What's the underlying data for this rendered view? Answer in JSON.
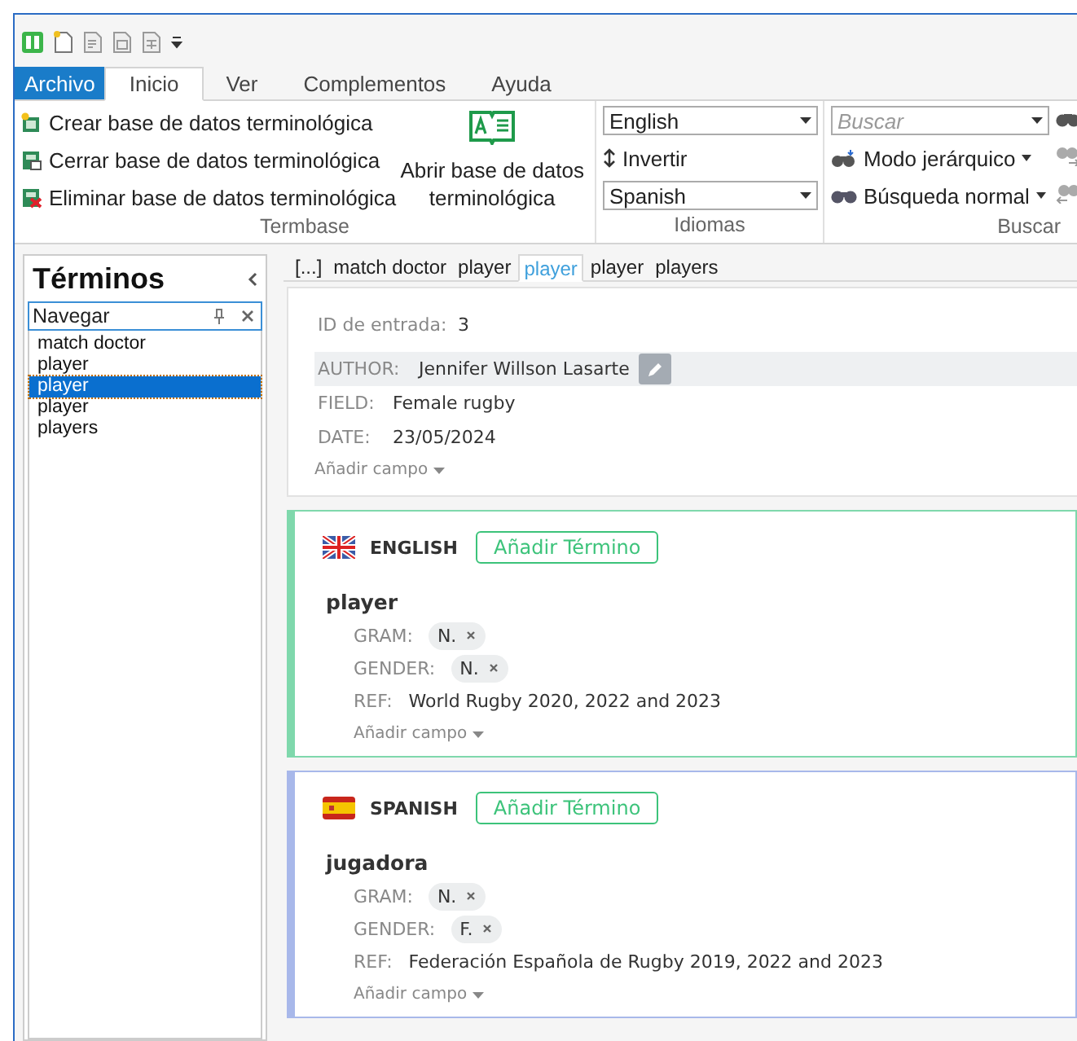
{
  "menu_tabs": [
    {
      "label": "Archivo",
      "kind": "file",
      "selected": false
    },
    {
      "label": "Inicio",
      "kind": "tab",
      "selected": true
    },
    {
      "label": "Ver",
      "kind": "tab",
      "selected": false
    },
    {
      "label": "Complementos",
      "kind": "tab",
      "selected": false
    },
    {
      "label": "Ayuda",
      "kind": "tab",
      "selected": false
    }
  ],
  "ribbon": {
    "termbase": {
      "caption": "Termbase",
      "commands": [
        {
          "label": "Crear base de datos terminológica",
          "kind": "create"
        },
        {
          "label": "Cerrar base de datos terminológica",
          "kind": "close"
        },
        {
          "label": "Eliminar base de datos terminológica",
          "kind": "delete"
        }
      ],
      "open_button": "Abrir base de datos terminológica"
    },
    "idiomas": {
      "caption": "Idiomas",
      "source": "English",
      "invert": "Invertir",
      "target": "Spanish"
    },
    "buscar": {
      "caption": "Buscar",
      "placeholder": "Buscar",
      "mode": "Modo jerárquico",
      "search_type": "Búsqueda normal"
    }
  },
  "sidebar": {
    "title": "Términos",
    "navigator": "Navegar",
    "items": [
      {
        "label": "match doctor",
        "selected": false
      },
      {
        "label": "player",
        "selected": false
      },
      {
        "label": "player",
        "selected": true
      },
      {
        "label": "player",
        "selected": false
      },
      {
        "label": "players",
        "selected": false
      }
    ]
  },
  "entry_tabs": [
    {
      "label": "[...]",
      "selected": false
    },
    {
      "label": "match doctor",
      "selected": false
    },
    {
      "label": "player",
      "selected": false
    },
    {
      "label": "player",
      "selected": true
    },
    {
      "label": "player",
      "selected": false
    },
    {
      "label": "players",
      "selected": false
    }
  ],
  "entry": {
    "id_label": "ID de entrada:",
    "id_value": "3",
    "fields": [
      {
        "label": "AUTHOR:",
        "value": "Jennifer Willson Lasarte",
        "highlighted": true
      },
      {
        "label": "FIELD:",
        "value": "Female rugby",
        "highlighted": false
      },
      {
        "label": "DATE:",
        "value": "23/05/2024",
        "highlighted": false
      }
    ],
    "add_field": "Añadir campo"
  },
  "languages": [
    {
      "name": "ENGLISH",
      "kind": "uk",
      "color": "#7fd8ac",
      "add_term": "Añadir Término",
      "term": "player",
      "fields": [
        {
          "label": "GRAM:",
          "value": "N.",
          "kind": "chip"
        },
        {
          "label": "GENDER:",
          "value": "N.",
          "kind": "chip"
        },
        {
          "label": "REF:",
          "value": "World Rugby 2020, 2022 and 2023",
          "kind": "text"
        }
      ],
      "add_field": "Añadir campo"
    },
    {
      "name": "SPANISH",
      "kind": "es",
      "color": "#a8b8ea",
      "add_term": "Añadir Término",
      "term": "jugadora",
      "fields": [
        {
          "label": "GRAM:",
          "value": "N.",
          "kind": "chip"
        },
        {
          "label": "GENDER:",
          "value": "F.",
          "kind": "chip"
        },
        {
          "label": "REF:",
          "value": "Federación Española de Rugby 2019, 2022 and 2023",
          "kind": "text"
        }
      ],
      "add_field": "Añadir campo"
    }
  ]
}
